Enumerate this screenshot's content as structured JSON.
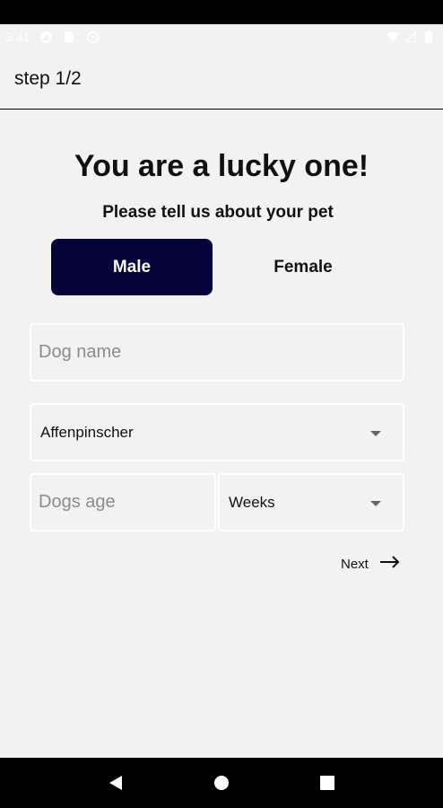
{
  "status_bar": {
    "time": "3:41",
    "icons": [
      "notification-icon",
      "sim-icon",
      "data-saver-icon",
      "wifi-icon",
      "signal-icon",
      "battery-icon"
    ]
  },
  "app_bar": {
    "title": "step 1/2"
  },
  "main": {
    "headline": "You are a lucky one!",
    "subheadline": "Please tell us about your pet",
    "gender": {
      "male_label": "Male",
      "female_label": "Female",
      "selected": "Male"
    },
    "dog_name": {
      "value": "",
      "placeholder": "Dog name"
    },
    "breed": {
      "value": "Affenpinscher"
    },
    "age": {
      "value": "",
      "placeholder": "Dogs age"
    },
    "age_unit": {
      "value": "Weeks"
    },
    "next_label": "Next"
  },
  "nav_bar": {
    "buttons": [
      "back-icon",
      "home-icon",
      "recents-icon"
    ]
  },
  "colors": {
    "accent": "#04043a",
    "background": "#f2f2f2",
    "field_border": "#ffffff"
  }
}
